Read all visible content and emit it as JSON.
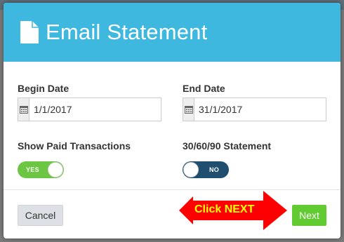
{
  "colors": {
    "header": "#3fb8e0",
    "toggle_on": "#6cc644",
    "toggle_off": "#1f4e6e",
    "next_button": "#62cb31",
    "arrow": "#ff0000",
    "arrow_text": "#ffff00"
  },
  "modal": {
    "title": "Email Statement",
    "title_icon": "document-icon"
  },
  "form": {
    "begin_date": {
      "label": "Begin Date",
      "value": "1/1/2017",
      "icon": "calendar-icon"
    },
    "end_date": {
      "label": "End Date",
      "value": "31/1/2017",
      "icon": "calendar-icon"
    },
    "show_paid": {
      "label": "Show Paid Transactions",
      "state": "YES"
    },
    "statement_306090": {
      "label": "30/60/90 Statement",
      "state": "NO"
    }
  },
  "footer": {
    "cancel_label": "Cancel",
    "next_label": "Next"
  },
  "annotation": {
    "text": "Click NEXT"
  }
}
